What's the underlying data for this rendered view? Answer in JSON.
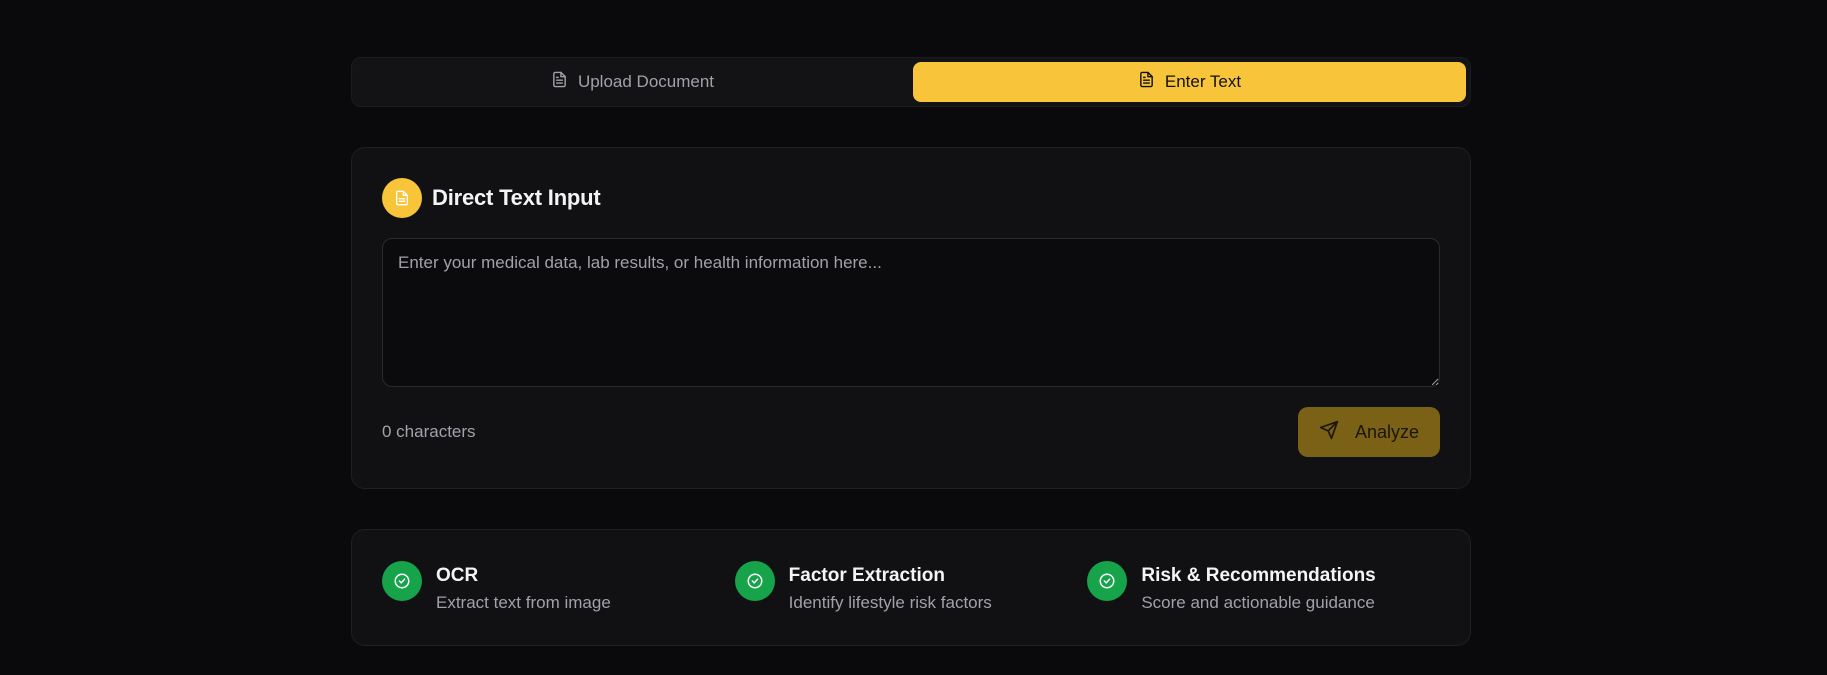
{
  "tabs": [
    {
      "label": "Upload Document",
      "icon": "document-icon",
      "active": false
    },
    {
      "label": "Enter Text",
      "icon": "document-icon",
      "active": true
    }
  ],
  "card": {
    "title": "Direct Text Input",
    "icon": "document-icon",
    "textarea": {
      "value": "",
      "placeholder": "Enter your medical data, lab results, or health information here..."
    },
    "char_count": "0 characters",
    "analyze_label": "Analyze",
    "analyze_icon": "send-icon"
  },
  "features": [
    {
      "title": "OCR",
      "desc": "Extract text from image",
      "icon": "check-circle-icon"
    },
    {
      "title": "Factor Extraction",
      "desc": "Identify lifestyle risk factors",
      "icon": "check-circle-icon"
    },
    {
      "title": "Risk & Recommendations",
      "desc": "Score and actionable guidance",
      "icon": "check-circle-icon"
    }
  ],
  "colors": {
    "accent": "#f8c53a",
    "success": "#16a34a",
    "background": "#0a0a0c",
    "card": "#111114"
  }
}
